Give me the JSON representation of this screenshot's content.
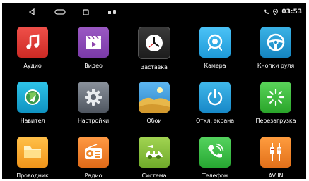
{
  "status_bar": {
    "icons": [
      "back-icon",
      "home-icon",
      "recents-icon",
      "notification-icon",
      "phone-icon",
      "location-icon"
    ],
    "time": "03:53"
  },
  "apps": [
    {
      "label": "Аудио",
      "icon": "music-note-icon",
      "color": "#e53935"
    },
    {
      "label": "Видео",
      "icon": "clapperboard-icon",
      "color": "#8e44ad"
    },
    {
      "label": "Заставка",
      "icon": "clock-icon",
      "color": "#2b2b2b"
    },
    {
      "label": "Камера",
      "icon": "camera-icon",
      "color": "#29b6f6"
    },
    {
      "label": "Кнопки руля",
      "icon": "steering-wheel-icon",
      "color": "#1ea0d8"
    },
    {
      "label": "Навител",
      "icon": "navigation-globe-icon",
      "color": "#1fb3d8"
    },
    {
      "label": "Настройки",
      "icon": "gear-icon",
      "color": "#6b7280"
    },
    {
      "label": "Обои",
      "icon": "wallpaper-landscape-icon",
      "color": "#4aa3df"
    },
    {
      "label": "Откл. экрана",
      "icon": "power-icon",
      "color": "#2aa7de"
    },
    {
      "label": "Перезагрузка",
      "icon": "reboot-icon",
      "color": "#43c043"
    },
    {
      "label": "Проводник",
      "icon": "folder-icon",
      "color": "#f5a623"
    },
    {
      "label": "Радио",
      "icon": "radio-icon",
      "color": "#f0822d"
    },
    {
      "label": "Система",
      "icon": "car-system-icon",
      "color": "#8dc63f"
    },
    {
      "label": "Телефон",
      "icon": "phone-handset-icon",
      "color": "#3fbf4a"
    },
    {
      "label": "AV IN",
      "icon": "av-cable-icon",
      "color": "#f08a24"
    }
  ]
}
